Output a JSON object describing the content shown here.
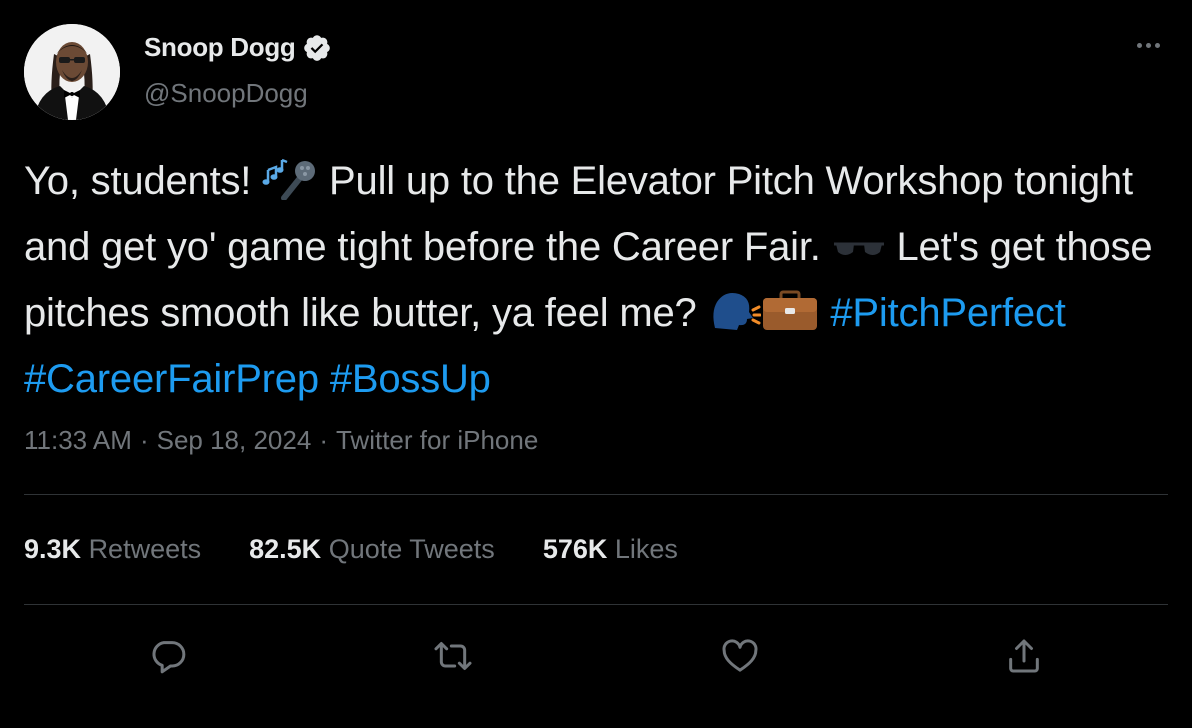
{
  "author": {
    "display_name": "Snoop Dogg",
    "handle": "@SnoopDogg",
    "verified": true,
    "avatar_icon": "avatar-photo"
  },
  "tweet": {
    "text_part1": "Yo, students! ",
    "emoji1": "musical-notes-microphone",
    "text_part2": " Pull up to the Elevator Pitch Workshop tonight and get yo' game tight before the Career Fair. ",
    "emoji2": "sunglasses",
    "text_part3": " Let's get those pitches smooth like butter, ya feel me? ",
    "emoji3": "speaking-head",
    "emoji4": "briefcase",
    "hashtags": [
      "#PitchPerfect",
      "#CareerFairPrep",
      "#BossUp"
    ]
  },
  "meta": {
    "time": "11:33 AM",
    "separator": "·",
    "date": "Sep 18, 2024",
    "source": "Twitter for iPhone"
  },
  "stats": {
    "retweets_count": "9.3K",
    "retweets_label": "Retweets",
    "quotes_count": "82.5K",
    "quotes_label": "Quote Tweets",
    "likes_count": "576K",
    "likes_label": "Likes"
  },
  "actions": [
    "reply-icon",
    "retweet-icon",
    "like-icon",
    "share-icon"
  ],
  "colors": {
    "background": "#000000",
    "text": "#e7e9ea",
    "muted": "#71767b",
    "accent": "#1d9bf0",
    "divider": "#2f3336"
  }
}
